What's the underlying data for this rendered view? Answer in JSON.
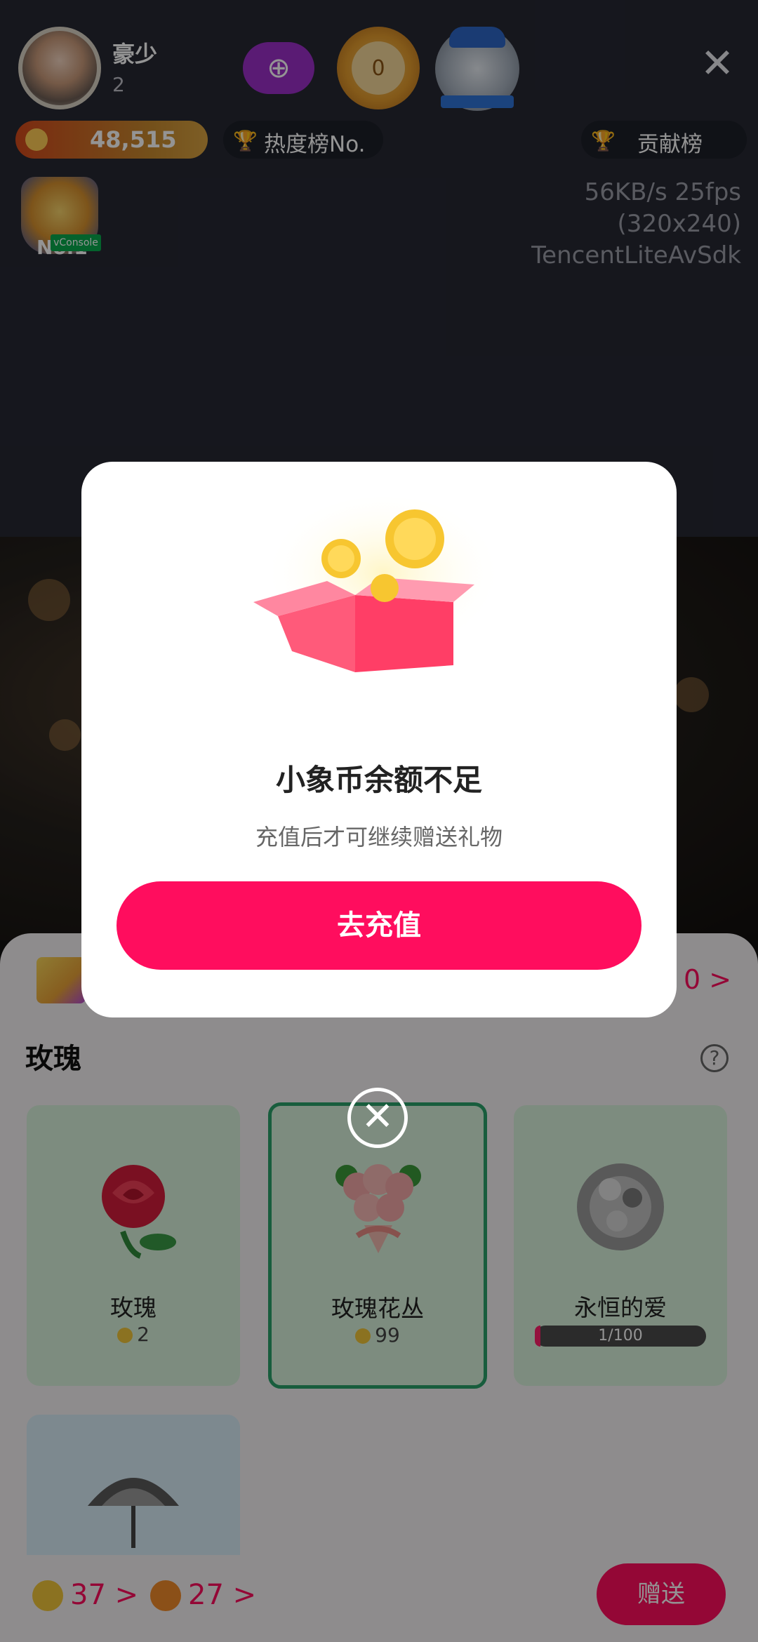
{
  "header": {
    "host_name": "豪少",
    "host_level": "2",
    "gold_medal_value": "0",
    "coin_balance": "48,515",
    "heat_rank_label": "热度榜No.",
    "contribution_label": "贡献榜",
    "rank_badge_text": "No.1",
    "vconsole_label": "vConsole",
    "stream_stats": [
      "56KB/s 25fps",
      "(320x240)",
      "TencentLiteAvSdk"
    ]
  },
  "dialog": {
    "title": "小象币余额不足",
    "subtitle": "充值后才可继续赠送礼物",
    "recharge_button": "去充值"
  },
  "gift_panel": {
    "balance_partial": "0 >",
    "section_title": "玫瑰",
    "help_icon": "?",
    "gifts": [
      {
        "name": "玫瑰",
        "price": "2"
      },
      {
        "name": "玫瑰花丛",
        "price": "99"
      },
      {
        "name": "永恒的爱",
        "progress_text": "1/100",
        "progress_fraction": 0.01
      }
    ],
    "wallet": [
      {
        "amount": "37",
        "chevron": ">"
      },
      {
        "amount": "27",
        "chevron": ">"
      }
    ],
    "send_button": "赠送"
  },
  "icons": {
    "close": "close-icon",
    "remove_selection": "remove-selection-icon",
    "follow": "follow-plus-icon"
  },
  "colors": {
    "accent": "#ff0d5e",
    "selected_border": "#2aa06a"
  }
}
